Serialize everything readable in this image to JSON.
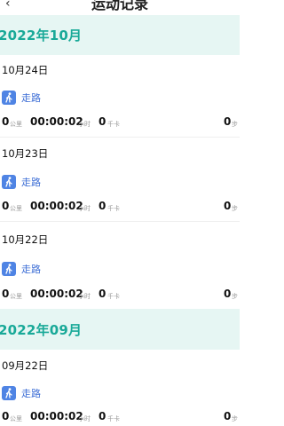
{
  "header": {
    "title": "运动记录"
  },
  "months": [
    {
      "label": "2022年10月",
      "records": [
        {
          "date": "10月24日",
          "activity": "走路",
          "distance": "0",
          "distance_unit": "公里",
          "duration": "00:00:02",
          "duration_unit": "小时",
          "calories": "0",
          "calories_unit": "千卡",
          "steps": "0",
          "steps_unit": "步"
        },
        {
          "date": "10月23日",
          "activity": "走路",
          "distance": "0",
          "distance_unit": "公里",
          "duration": "00:00:02",
          "duration_unit": "小时",
          "calories": "0",
          "calories_unit": "千卡",
          "steps": "0",
          "steps_unit": "步"
        },
        {
          "date": "10月22日",
          "activity": "走路",
          "distance": "0",
          "distance_unit": "公里",
          "duration": "00:00:02",
          "duration_unit": "小时",
          "calories": "0",
          "calories_unit": "千卡",
          "steps": "0",
          "steps_unit": "步"
        }
      ]
    },
    {
      "label": "2022年09月",
      "records": [
        {
          "date": "09月22日",
          "activity": "走路",
          "distance": "0",
          "distance_unit": "公里",
          "duration": "00:00:02",
          "duration_unit": "小时",
          "calories": "0",
          "calories_unit": "千卡",
          "steps": "0",
          "steps_unit": "步"
        }
      ]
    }
  ],
  "colors": {
    "accent": "#19a998",
    "month_bg": "#e6f6f3",
    "activity": "#3f6fd6",
    "icon_bg": "#4f84e4"
  },
  "icons": {
    "activity": "walking-person-icon",
    "back": "chevron-left-icon"
  }
}
